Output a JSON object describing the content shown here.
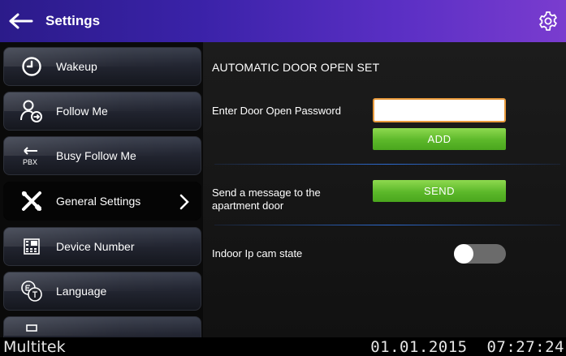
{
  "header": {
    "title": "Settings",
    "back_icon": "arrow-left-icon",
    "settings_icon": "gear-icon"
  },
  "sidebar": {
    "items": [
      {
        "label": "Wakeup",
        "icon": "clock-icon"
      },
      {
        "label": "Follow Me",
        "icon": "user-forward-icon"
      },
      {
        "label": "Busy Follow Me",
        "icon": "pbx-icon",
        "icon_text": "PBX"
      },
      {
        "label": "General Settings",
        "icon": "tools-icon",
        "active": true
      },
      {
        "label": "Device Number",
        "icon": "keypad-icon"
      },
      {
        "label": "Language",
        "icon": "language-icon"
      },
      {
        "label": "",
        "icon": "partial-item-icon"
      }
    ]
  },
  "main": {
    "section_title": "AUTOMATIC DOOR OPEN SET",
    "password_label": "Enter Door Open Password",
    "password_value": "",
    "password_placeholder": "",
    "add_button": "ADD",
    "message_label_line1": "Send a message to the",
    "message_label_line2": "apartment door",
    "send_button": "SEND",
    "ipcam_label": "Indoor Ip cam state",
    "ipcam_toggle_on": false
  },
  "footer": {
    "brand": "Multitek",
    "date": "01.01.2015",
    "time": "07:27:24"
  },
  "colors": {
    "header_gradient_start": "#2b1b8a",
    "header_gradient_end": "#7a3ccf",
    "button_green": "#5cb82a",
    "input_border": "#e89a3c",
    "divider_blue": "#2d6bd1",
    "toggle_off": "#6b6b6b"
  }
}
